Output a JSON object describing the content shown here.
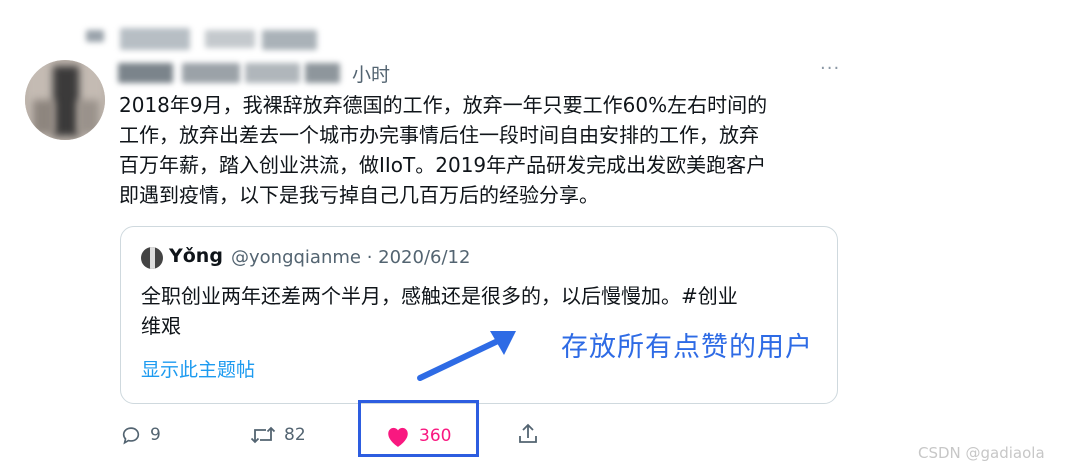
{
  "tweet": {
    "time_suffix": "小时",
    "more_label": "···",
    "text_lines": [
      "2018年9月，我裸辞放弃德国的工作，放弃一年只要工作60%左右时间的",
      "工作，放弃出差去一个城市办完事情后住一段时间自由安排的工作，放弃",
      "百万年薪，踏入创业洪流，做IIoT。2019年产品研发完成出发欧美跑客户",
      "即遇到疫情，以下是我亏掉自己几百万后的经验分享。"
    ]
  },
  "quote": {
    "name": "Yǒng",
    "handle_date": "@yongqianme · 2020/6/12",
    "text_lines": [
      "全职创业两年还差两个半月，感触还是很多的，以后慢慢加。#创业",
      "维艰"
    ],
    "show_thread_label": "显示此主题帖"
  },
  "actions": {
    "reply_count": "9",
    "retweet_count": "82",
    "like_count": "360"
  },
  "annotation": {
    "text": "存放所有点赞的用户",
    "color": "#2e6be5"
  },
  "colors": {
    "like": "#f91880",
    "link": "#1d9bf0",
    "highlight_box": "#2d5de0"
  },
  "watermark": "CSDN @gadiaola"
}
